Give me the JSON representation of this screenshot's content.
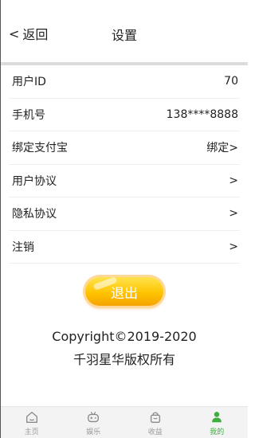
{
  "header": {
    "back_chevron": "<",
    "back_label": "返回",
    "title": "设置"
  },
  "settings": [
    {
      "label": "用户ID",
      "value": "70"
    },
    {
      "label": "手机号",
      "value": "138****8888"
    },
    {
      "label": "绑定支付宝",
      "value": "绑定>"
    },
    {
      "label": "用户协议",
      "value": ">"
    },
    {
      "label": "隐私协议",
      "value": ">"
    },
    {
      "label": "注销",
      "value": ">"
    }
  ],
  "logout_label": "退出",
  "copyright": {
    "line1": "Copyright©2019-2020",
    "line2": "千羽星华版权所有"
  },
  "tabs": [
    {
      "label": "主页",
      "icon": "home-icon"
    },
    {
      "label": "娱乐",
      "icon": "gamepad-icon"
    },
    {
      "label": "收益",
      "icon": "bag-icon"
    },
    {
      "label": "我的",
      "icon": "user-icon"
    }
  ],
  "colors": {
    "accent": "#3fae3f",
    "button": "#ffc400"
  }
}
